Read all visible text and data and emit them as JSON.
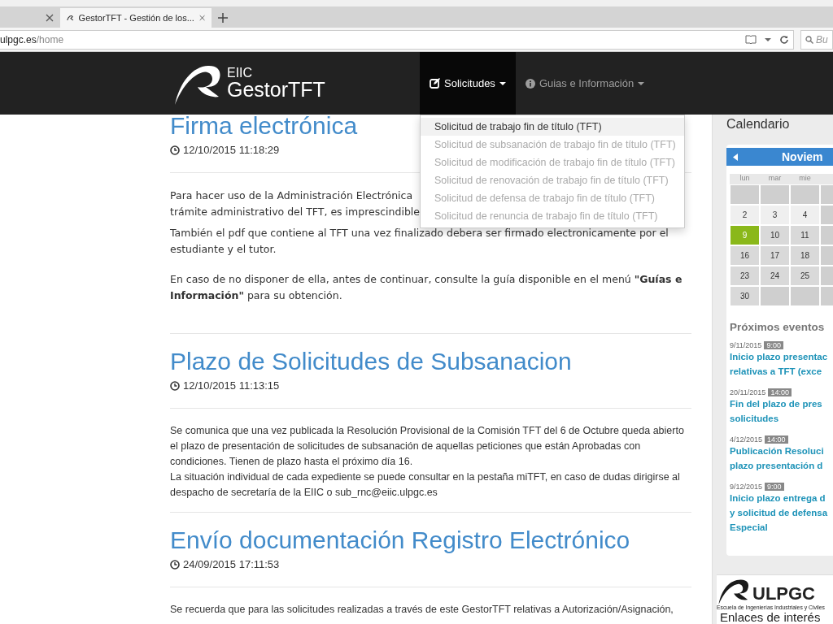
{
  "browser": {
    "tabs": [
      {
        "selected": false
      },
      {
        "title": "GestorTFT - Gestión de los...",
        "selected": true
      }
    ],
    "address": {
      "host": "ulpgc.es",
      "path": "/home"
    },
    "search": {
      "placeholder": "Bu"
    }
  },
  "navbar": {
    "logo": {
      "small": "EIIC",
      "big": "GestorTFT"
    },
    "items": [
      {
        "label": "Solicitudes",
        "kind": "edit",
        "selected": true
      },
      {
        "label": "Guias e Información",
        "kind": "info",
        "selected": false
      }
    ]
  },
  "dropdown": [
    {
      "label": "Solicitud de trabajo fin de título (TFT)",
      "disabled": false,
      "highlighted": true
    },
    {
      "label": "Solicitud de subsanación de trabajo fin de título (TFT)",
      "disabled": true,
      "highlighted": false
    },
    {
      "label": "Solicitud de modificación de trabajo fin de título (TFT)",
      "disabled": true,
      "highlighted": false
    },
    {
      "label": "Solicitud de renovación de trabajo fin de título (TFT)",
      "disabled": true,
      "highlighted": false
    },
    {
      "label": "Solicitud de defensa de trabajo fin de título (TFT)",
      "disabled": true,
      "highlighted": false
    },
    {
      "label": "Solicitud de renuncia de trabajo fin de título (TFT)",
      "disabled": true,
      "highlighted": false
    }
  ],
  "posts": [
    {
      "title": "Firma electrónica",
      "date": "12/10/2015 11:18:29",
      "paragraphs": [
        "Para hacer uso de la Administración Electrónica\ntrámite administrativo del TFT, es imprescindible",
        "También el pdf que contiene al TFT una vez finalizado debera ser firmado electronicamente por el estudiante y el tutor.",
        "En caso de no disponer de ella, antes de continuar, consulte la guía disponible en el menú **\"Guías e Información\"** para su obtención."
      ]
    },
    {
      "title": "Plazo de Solicitudes de Subsanacion",
      "date": "12/10/2015 11:13:15",
      "paragraphs": [
        "Se comunica que una vez publicada la Resolución Provisional de la Comisión TFT del 6 de Octubre queda abierto el plazo de presentación de solicitudes de subsanación de aquellas peticiones que están Aprobadas con condiciones. Tienen de plazo hasta el próximo día 16.\nLa situación individual de cada expediente se puede consultar en la pestaña miTFT, en caso de dudas dirigirse al despacho de secretaría de la EIIC o sub_rnc@eiic.ulpgc.es"
      ]
    },
    {
      "title": "Envío documentación Registro Electrónico",
      "date": "24/09/2015 17:11:53",
      "paragraphs": [
        "Se recuerda que para las solicitudes realizadas a través de este GestorTFT relativas a Autorización/Asignación,"
      ]
    }
  ],
  "sidebar": {
    "calendar": {
      "title": "Calendario",
      "month": "Noviem",
      "weekdays": [
        "lun",
        "mar",
        "mie"
      ],
      "weeks": [
        {
          "days": [
            {
              "day": "2",
              "today": false
            },
            {
              "day": "3",
              "today": false
            },
            {
              "day": "4",
              "today": false
            }
          ]
        },
        {
          "days": [
            {
              "day": "9",
              "today": true
            },
            {
              "day": "10",
              "today": false
            },
            {
              "day": "11",
              "today": false
            }
          ]
        },
        {
          "days": [
            {
              "day": "16",
              "today": false
            },
            {
              "day": "17",
              "today": false
            },
            {
              "day": "18",
              "today": false
            }
          ]
        },
        {
          "days": [
            {
              "day": "23",
              "today": false
            },
            {
              "day": "24",
              "today": false
            },
            {
              "day": "25",
              "today": false
            }
          ]
        },
        {
          "days": [
            {
              "day": "30",
              "today": false
            }
          ]
        }
      ]
    },
    "events_title": "Próximos eventos",
    "events": [
      {
        "date": "9/11/2015",
        "time": "9:00",
        "title": "Inicio plazo presentac\nrelativas a TFT (exce"
      },
      {
        "date": "20/11/2015",
        "time": "14:00",
        "title": "Fin del plazo de pres\nsolicitudes"
      },
      {
        "date": "4/12/2015",
        "time": "14:00",
        "title": "Publicación Resoluci\nplazo presentación d"
      },
      {
        "date": "9/12/2015",
        "time": "9:00",
        "title": "Inicio plazo entrega d\ny solicitud de defensa\nEspecial"
      }
    ],
    "school_logo": {
      "name": "ULPGC",
      "caption": "Escuela de Ingenierías Industriales y Civiles"
    },
    "links_title": "Enlaces de interés"
  }
}
